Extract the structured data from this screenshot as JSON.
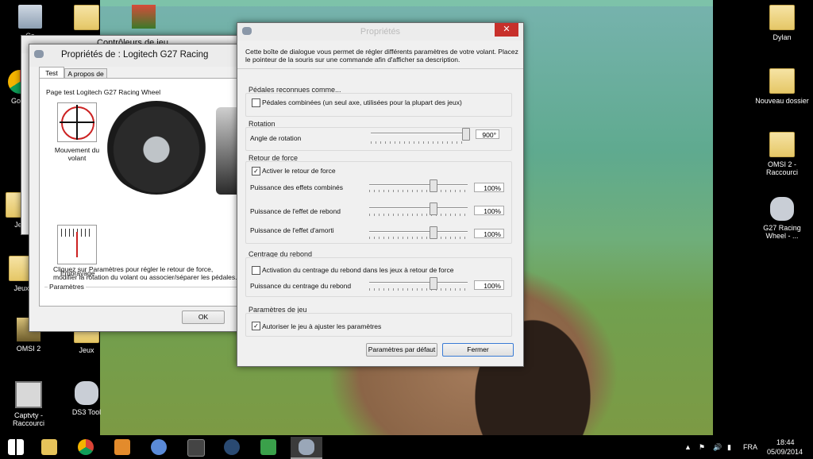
{
  "desktop": {
    "left_icons": [
      {
        "label": "Co",
        "type": "recycle-bin"
      },
      {
        "label": "Goog",
        "type": "chrome"
      },
      {
        "label": "Je",
        "type": "folder"
      },
      {
        "label": "Jeux",
        "type": "folder"
      },
      {
        "label": "OMSI 2",
        "type": "game"
      },
      {
        "label": "Jeux",
        "type": "folder"
      },
      {
        "label": "Captvty - Raccourci",
        "type": "monitor"
      },
      {
        "label": "DS3 Tool",
        "type": "gamepad"
      }
    ],
    "right_icons": [
      {
        "label": "Dylan",
        "type": "folder"
      },
      {
        "label": "Nouveau dossier",
        "type": "folder"
      },
      {
        "label": "OMSI 2 - Raccourci",
        "type": "folder"
      },
      {
        "label": "G27 Racing Wheel - ...",
        "type": "gamepad"
      }
    ]
  },
  "back_window": {
    "title": "Contrôleurs de jeu"
  },
  "props_window": {
    "title": "Propriétés de : Logitech G27 Racing",
    "tabs": [
      "Test",
      "A propos de"
    ],
    "active_tab": "Test",
    "page_title": "Page test Logitech G27 Racing Wheel",
    "wheel_label": "Mouvement du volant",
    "clutch_label": "Embrayage",
    "params_group": "Paramètres",
    "params_text": "Cliquez sur Paramètres pour régler le retour de force, modifier la rotation du volant ou associer/séparer les pédales.",
    "ok": "OK"
  },
  "settings_dialog": {
    "title": "Propriétés",
    "close": "✕",
    "intro": "Cette boîte de dialogue vous permet de régler différents paramètres de votre volant. Placez le pointeur de la souris sur une commande afin d'afficher sa description.",
    "pedals": {
      "group": "Pédales reconnues comme...",
      "combined_label": "Pédales combinées (un seul axe, utilisées pour la plupart des jeux)",
      "combined_checked": false
    },
    "rotation": {
      "group": "Rotation",
      "angle_label": "Angle de rotation",
      "angle_value": "900°",
      "angle_fraction": 1.0
    },
    "force": {
      "group": "Retour de force",
      "enable_label": "Activer le retour de force",
      "enable_checked": true,
      "combined_label": "Puissance des effets combinés",
      "combined_value": "100%",
      "spring_label": "Puissance de l'effet de rebond",
      "spring_value": "100%",
      "damper_label": "Puissance de l'effet d'amorti",
      "damper_value": "100%"
    },
    "centering": {
      "group": "Centrage du rebond",
      "enable_label": "Activation du centrage du rebond dans les jeux à retour de force",
      "enable_checked": false,
      "strength_label": "Puissance du centrage du rebond",
      "strength_value": "100%"
    },
    "game": {
      "group": "Paramètres de jeu",
      "allow_label": "Autoriser le jeu à ajuster les paramètres",
      "allow_checked": true
    },
    "default_button": "Paramètres par défaut",
    "close_button": "Fermer"
  },
  "taskbar": {
    "language": "FRA",
    "time": "18:44",
    "date": "05/09/2014"
  },
  "colors": {
    "close_red": "#c7302b",
    "focus_blue": "#3a7bd5",
    "taskbar": "#000000"
  }
}
